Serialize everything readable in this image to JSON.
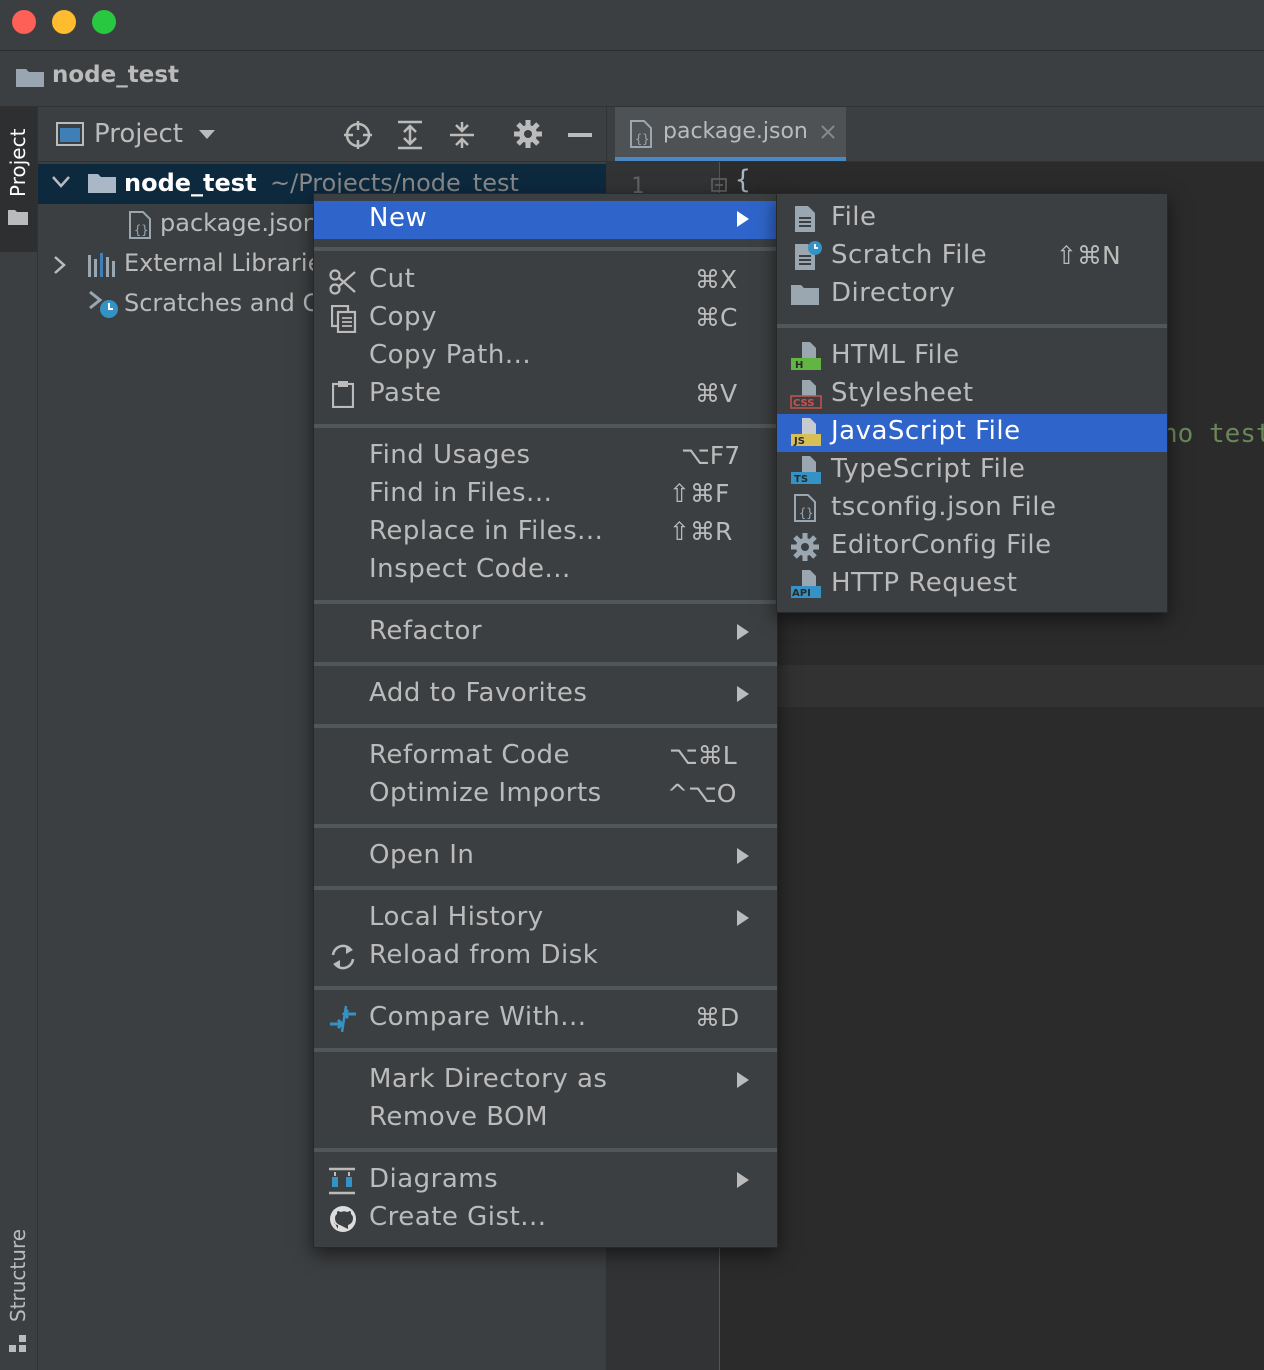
{
  "window": {
    "title": "node_test",
    "traffic_colors": [
      "#fe5f57",
      "#febc2e",
      "#28c840"
    ]
  },
  "left_strip": {
    "top_tab": "Project",
    "bottom_tab": "Structure"
  },
  "project_panel": {
    "header_label": "Project",
    "tree": [
      {
        "label": "node_test",
        "path": "~/Projects/node_test",
        "icon": "folder-icon"
      },
      {
        "label": "package.json",
        "icon": "json-file-icon"
      },
      {
        "label": "External Libraries",
        "icon": "libraries-icon"
      },
      {
        "label": "Scratches and Consoles",
        "icon": "scratches-icon"
      }
    ]
  },
  "editor": {
    "tab_label": "package.json",
    "line_number": "1",
    "first_line": "{",
    "visible_code_fragment": "no test"
  },
  "context_menu": {
    "new": "New",
    "cut": "Cut",
    "cut_sc": "⌘X",
    "copy": "Copy",
    "copy_sc": "⌘C",
    "copy_path": "Copy Path...",
    "paste": "Paste",
    "paste_sc": "⌘V",
    "find_usages": "Find Usages",
    "find_usages_sc": "⌥F7",
    "find_in_files": "Find in Files...",
    "find_in_files_sc": "⇧⌘F",
    "replace_in_files": "Replace in Files...",
    "replace_in_files_sc": "⇧⌘R",
    "inspect_code": "Inspect Code...",
    "refactor": "Refactor",
    "add_to_favorites": "Add to Favorites",
    "reformat_code": "Reformat Code",
    "reformat_code_sc": "⌥⌘L",
    "optimize_imports": "Optimize Imports",
    "optimize_imports_sc": "^⌥O",
    "open_in": "Open In",
    "local_history": "Local History",
    "reload_from_disk": "Reload from Disk",
    "compare_with": "Compare With...",
    "compare_with_sc": "⌘D",
    "mark_directory_as": "Mark Directory as",
    "remove_bom": "Remove BOM",
    "diagrams": "Diagrams",
    "create_gist": "Create Gist..."
  },
  "new_submenu": {
    "file": "File",
    "scratch_file": "Scratch File",
    "scratch_file_sc": "⇧⌘N",
    "directory": "Directory",
    "html_file": "HTML File",
    "html_badge": "H",
    "stylesheet": "Stylesheet",
    "css_badge": "CSS",
    "javascript_file": "JavaScript File",
    "js_badge": "JS",
    "typescript_file": "TypeScript File",
    "ts_badge": "TS",
    "tsconfig_file": "tsconfig.json File",
    "editorconfig_file": "EditorConfig File",
    "http_request": "HTTP Request",
    "api_badge": "API"
  },
  "colors": {
    "menu_highlight": "#2f65ca",
    "selection": "#0d293e",
    "accent": "#4a88c7"
  }
}
